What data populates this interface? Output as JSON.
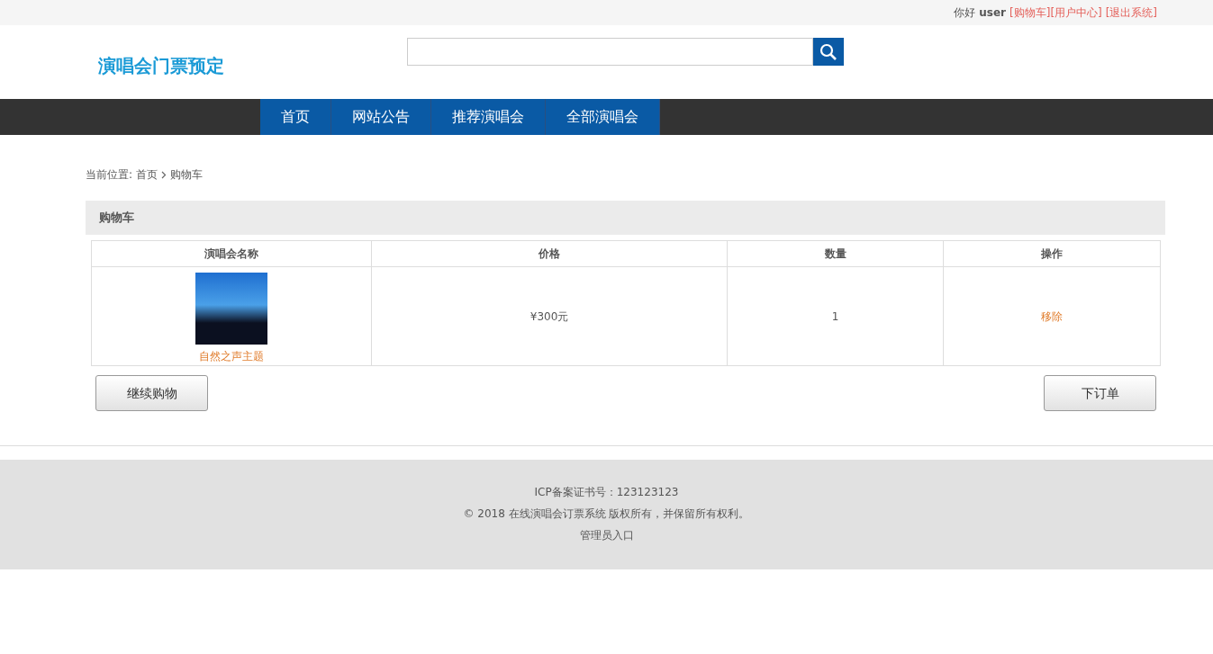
{
  "top_bar": {
    "greeting": "你好",
    "username": "user",
    "links": [
      "[购物车]",
      "[用户中心]",
      "[退出系统]"
    ]
  },
  "header": {
    "logo": "演唱会门票预定"
  },
  "nav": [
    "首页",
    "网站公告",
    "推荐演唱会",
    "全部演唱会"
  ],
  "breadcrumb": {
    "label": "当前位置:",
    "items": [
      "首页",
      "购物车"
    ]
  },
  "panel_title": "购物车",
  "table": {
    "columns": [
      "演唱会名称",
      "价格",
      "数量",
      "操作"
    ],
    "rows": [
      {
        "name": "自然之声主题",
        "price": "¥300元",
        "quantity": "1",
        "action": "移除"
      }
    ]
  },
  "buttons": [
    "继续购物",
    "下订单"
  ],
  "footer": [
    "ICP备案证书号：123123123",
    "© 2018 在线演唱会订票系统 版权所有，并保留所有权利。",
    "管理员入口"
  ]
}
